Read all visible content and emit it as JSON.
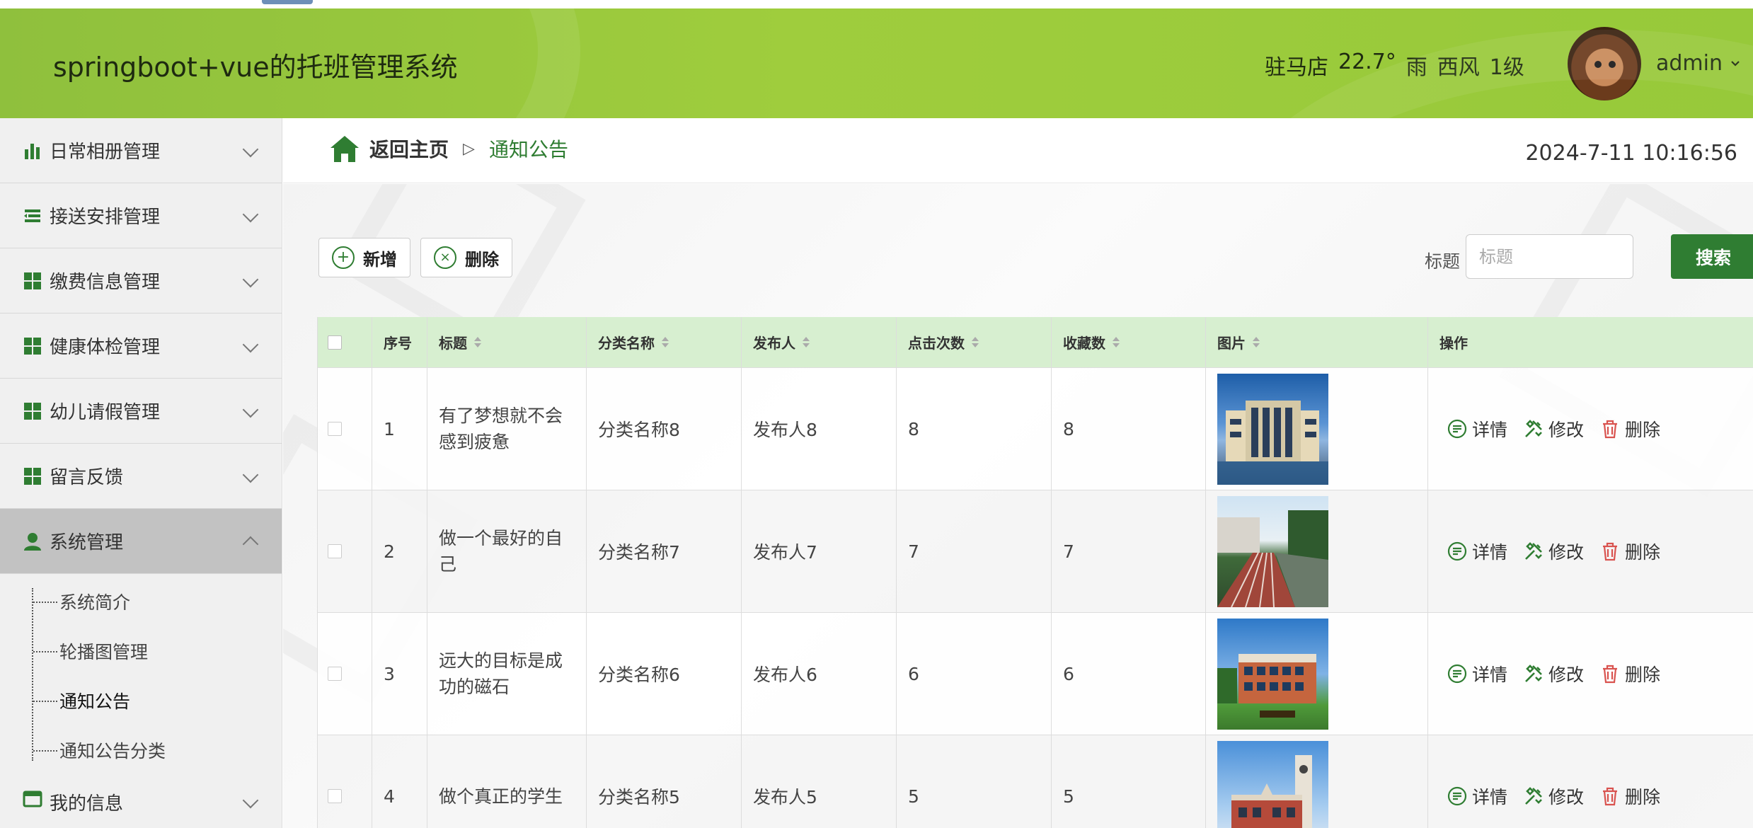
{
  "header": {
    "app_title": "springboot+vue的托班管理系统",
    "weather": {
      "city": "驻马店",
      "temp": "22.7°",
      "condition": "雨",
      "wind": "西风",
      "level": "1级"
    },
    "user": "admin"
  },
  "sidebar": {
    "items": [
      {
        "label": "日常相册管理",
        "icon": "bar-chart-icon"
      },
      {
        "label": "接送安排管理",
        "icon": "list-icon"
      },
      {
        "label": "缴费信息管理",
        "icon": "grid-icon"
      },
      {
        "label": "健康体检管理",
        "icon": "grid-icon"
      },
      {
        "label": "幼儿请假管理",
        "icon": "grid-icon"
      },
      {
        "label": "留言反馈",
        "icon": "grid-icon"
      },
      {
        "label": "系统管理",
        "icon": "user-icon"
      }
    ],
    "submenu": [
      "系统简介",
      "轮播图管理",
      "通知公告",
      "通知公告分类"
    ],
    "last_item": "我的信息"
  },
  "breadcrumb": {
    "home": "返回主页",
    "current": "通知公告"
  },
  "clock": "2024-7-11 10:16:56",
  "toolbar": {
    "add_label": "新增",
    "delete_label": "删除",
    "search_label": "标题",
    "search_placeholder": "标题",
    "search_button": "搜索"
  },
  "table": {
    "headers": [
      "序号",
      "标题",
      "分类名称",
      "发布人",
      "点击次数",
      "收藏数",
      "图片",
      "操作"
    ],
    "rows": [
      {
        "no": "1",
        "title": "有了梦想就不会感到疲惫",
        "category": "分类名称8",
        "publisher": "发布人8",
        "clicks": "8",
        "favorites": "8"
      },
      {
        "no": "2",
        "title": "做一个最好的自己",
        "category": "分类名称7",
        "publisher": "发布人7",
        "clicks": "7",
        "favorites": "7"
      },
      {
        "no": "3",
        "title": "远大的目标是成功的磁石",
        "category": "分类名称6",
        "publisher": "发布人6",
        "clicks": "6",
        "favorites": "6"
      },
      {
        "no": "4",
        "title": "做个真正的学生",
        "category": "分类名称5",
        "publisher": "发布人5",
        "clicks": "5",
        "favorites": "5"
      }
    ],
    "ops": {
      "detail": "详情",
      "edit": "修改",
      "delete": "删除"
    }
  },
  "colors": {
    "header_green": "#9fcd3d",
    "accent_green": "#2f7d32",
    "table_head": "#d7efd0",
    "delete_red": "#d9534f"
  }
}
